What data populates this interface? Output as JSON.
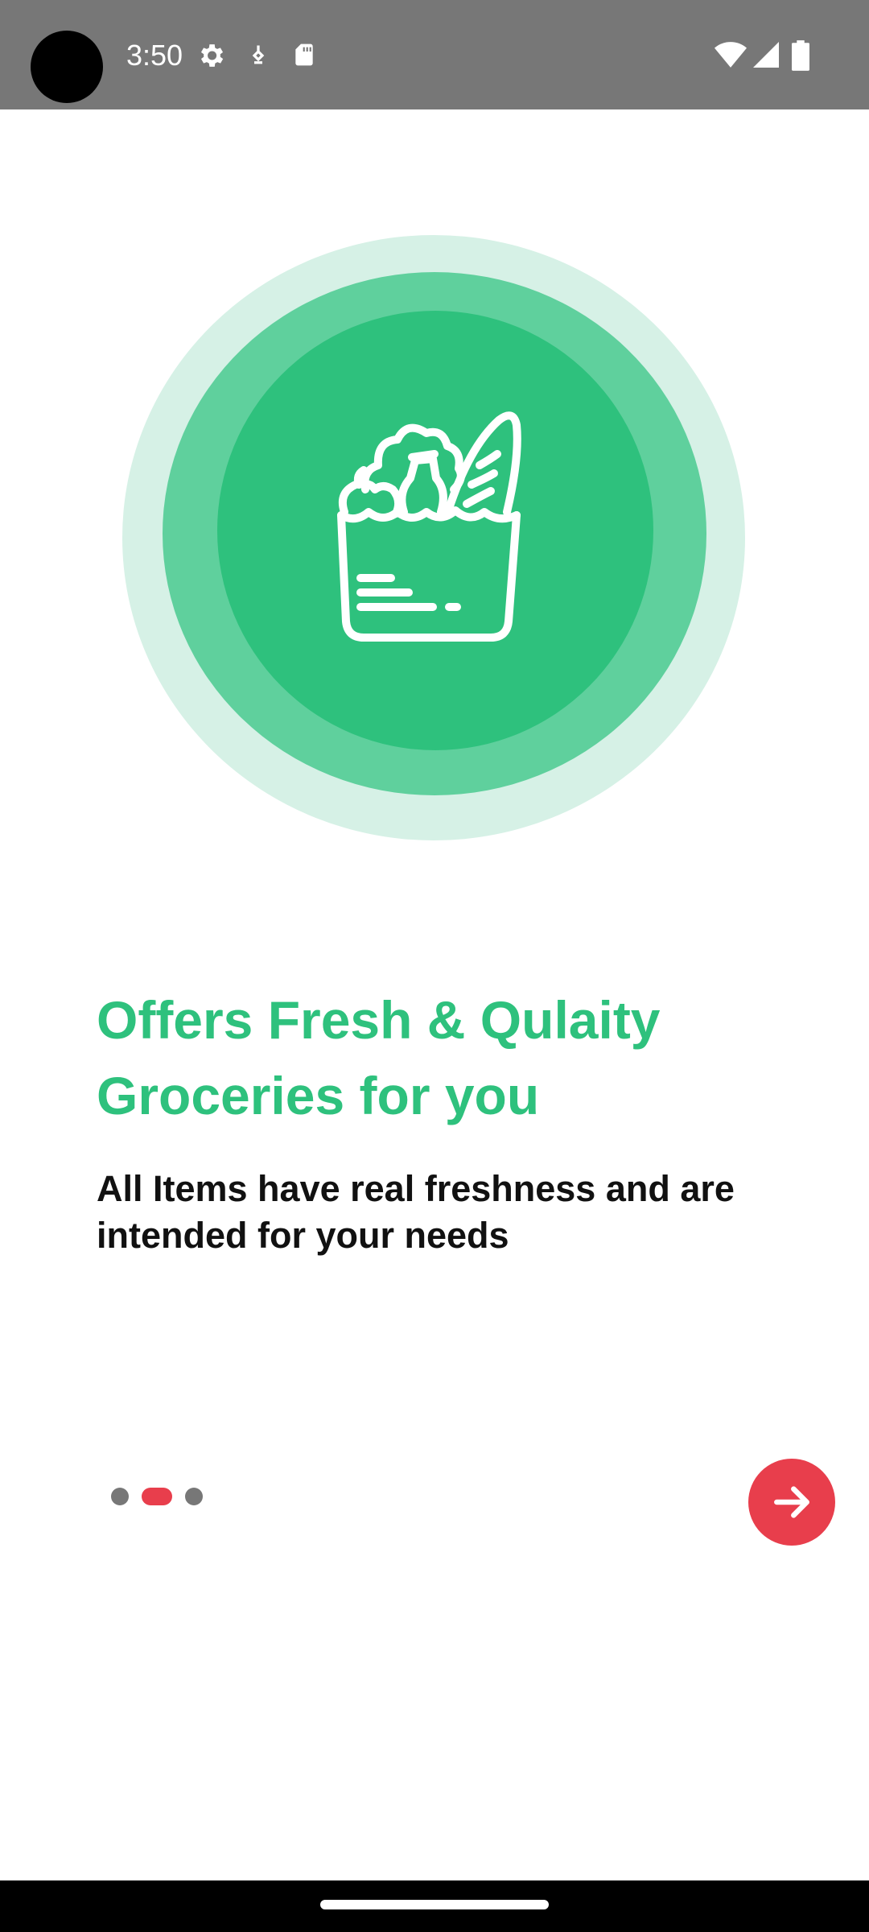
{
  "status_bar": {
    "time": "3:50",
    "icons_left": [
      "settings-gear-icon",
      "vpn-key-icon",
      "sd-card-icon"
    ],
    "icons_right": [
      "wifi-icon",
      "cellular-signal-icon",
      "battery-icon"
    ]
  },
  "onboarding": {
    "illustration": "grocery-bag-icon",
    "title": "Offers Fresh & Qulaity Groceries for you",
    "subtitle": "All Items have real freshness and are intended for your needs",
    "pager": {
      "page_count": 3,
      "current_page": 2
    },
    "next_icon": "arrow-right-icon"
  },
  "colors": {
    "accent_green": "#2ec17d",
    "accent_red": "#e83e4c",
    "status_bar": "#777777"
  }
}
